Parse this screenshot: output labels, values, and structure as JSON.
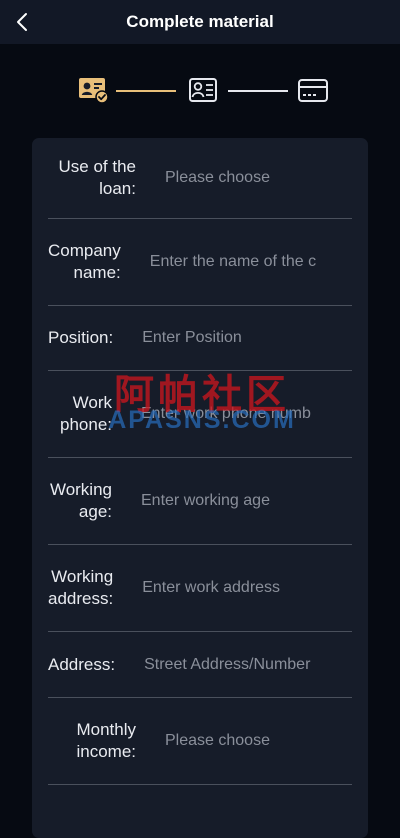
{
  "header": {
    "title": "Complete material",
    "back_icon": "chevron-left-icon"
  },
  "steps": [
    {
      "icon": "id-card-check-icon",
      "active": true
    },
    {
      "icon": "person-list-icon",
      "active": false
    },
    {
      "icon": "bank-card-icon",
      "active": false
    }
  ],
  "colors": {
    "accent": "#e8bf7a",
    "inactive": "#e6e8ee",
    "background": "#060a12",
    "card": "#161c29",
    "header": "#121826"
  },
  "form": {
    "rows": [
      {
        "label_1": "Use of the",
        "label_2": "loan:",
        "value": "Please choose"
      },
      {
        "label_1": "Company",
        "label_2": "name:",
        "value": "Enter the name of the c"
      },
      {
        "label_1": "Position:",
        "label_2": "",
        "value": "Enter Position"
      },
      {
        "label_1": "Work",
        "label_2": "phone:",
        "value": "Enter work phone numb"
      },
      {
        "label_1": "Working",
        "label_2": "age:",
        "value": "Enter working age"
      },
      {
        "label_1": "Working",
        "label_2": "address:",
        "value": "Enter work address"
      },
      {
        "label_1": "Address:",
        "label_2": "",
        "value": "Street Address/Number"
      },
      {
        "label_1": "Monthly",
        "label_2": "income:",
        "value": "Please choose"
      }
    ]
  },
  "watermark": {
    "cn": "阿帕社区",
    "en": "APASNS.COM"
  }
}
